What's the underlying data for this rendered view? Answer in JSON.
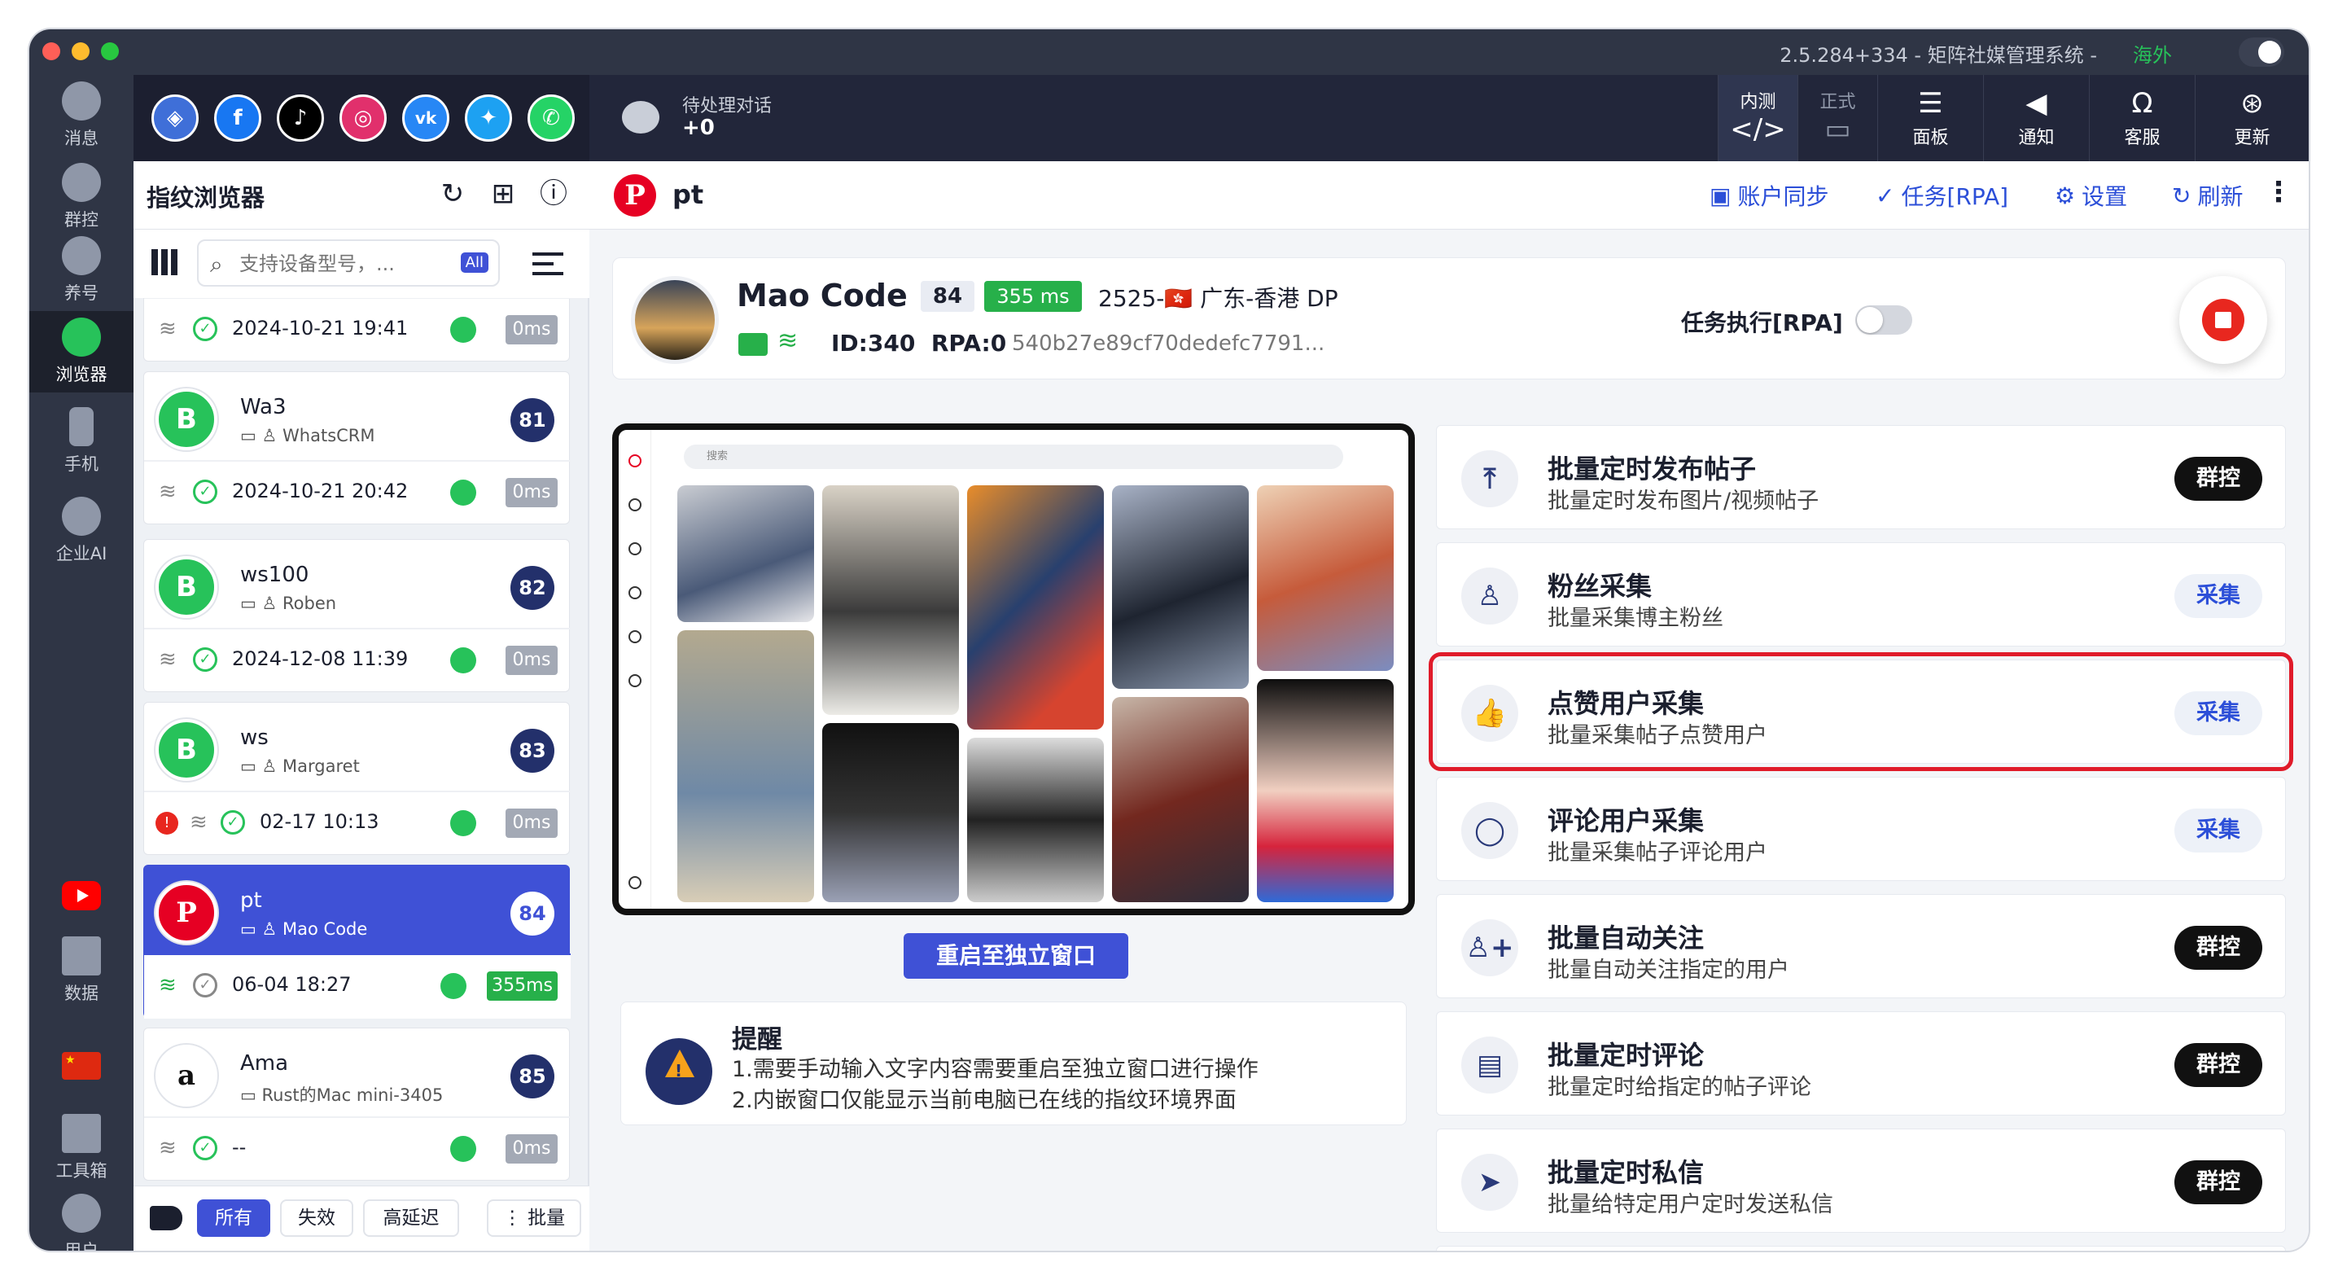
{
  "titlebar": {
    "title": "2.5.284+334 - 矩阵社媒管理系统 -",
    "region": "海外"
  },
  "colors": {
    "accent": "#3f51d6",
    "nav_bg": "#2f3545",
    "success": "#27b04a",
    "danger": "#e01b2a",
    "stop": "#e8271f"
  },
  "leftnav": {
    "messages": "消息",
    "group": "群控",
    "nurture": "养号",
    "browser": "浏览器",
    "phone": "手机",
    "enterprise_ai": "企业AI",
    "data": "数据",
    "toolbox": "工具箱",
    "user": "用户"
  },
  "topbar": {
    "pending_label": "待处理对话",
    "pending_count": "+0",
    "beta_label": "内测",
    "prod_label": "正式",
    "panel": "面板",
    "notify": "通知",
    "support": "客服",
    "update": "更新"
  },
  "social_icons": [
    "browser-icon",
    "facebook-icon",
    "tiktok-icon",
    "instagram-icon",
    "vk-icon",
    "twitter-icon",
    "whatsapp-icon"
  ],
  "sidepanel": {
    "title": "指纹浏览器",
    "search_placeholder": "支持设备型号，...",
    "all_badge": "All",
    "items": [
      {
        "name": "",
        "device": "",
        "owner": "",
        "num": "",
        "time": "2024-10-21 19:41",
        "ms": "0ms"
      },
      {
        "name": "Wa3",
        "owner": "WhatsCRM",
        "num": "81",
        "time": "2024-10-21 20:42",
        "ms": "0ms"
      },
      {
        "name": "ws100",
        "owner": "Roben",
        "num": "82",
        "time": "2024-12-08 11:39",
        "ms": "0ms"
      },
      {
        "name": "ws",
        "owner": "Margaret",
        "num": "83",
        "time": "02-17 10:13",
        "ms": "0ms"
      },
      {
        "name": "pt",
        "owner": "Mao Code",
        "num": "84",
        "time": "06-04 18:27",
        "ms": "355ms"
      },
      {
        "name": "Ama",
        "owner": "Rust的Mac mini-3405",
        "num": "85",
        "time": "--",
        "ms": "0ms"
      }
    ],
    "footer": {
      "all": "所有",
      "invalid": "失效",
      "high_latency": "高延迟",
      "batch": "批量"
    }
  },
  "main": {
    "header": {
      "title": "pt",
      "sync": "账户同步",
      "task": "任务[RPA]",
      "settings": "设置",
      "refresh": "刷新"
    },
    "profile": {
      "name": "Mao Code",
      "level": "84",
      "latency": "355 ms",
      "location": "2525-🇭🇰 广东-香港 DP",
      "id": "ID:340",
      "rpa": "RPA:0",
      "hash": "540b27e89cf70dedefc7791...",
      "task_label": "任务执行[RPA]"
    },
    "embed": {
      "search": "搜索",
      "reopen": "重启至独立窗口"
    },
    "notice": {
      "title": "提醒",
      "line1": "1.需要手动输入文字内容需要重启至独立窗口进行操作",
      "line2": "2.内嵌窗口仅能显示当前电脑已在线的指纹环境界面"
    },
    "features": [
      {
        "title": "批量定时发布帖子",
        "desc": "批量定时发布图片/视频帖子",
        "btn": "群控"
      },
      {
        "title": "粉丝采集",
        "desc": "批量采集博主粉丝",
        "btn": "采集"
      },
      {
        "title": "点赞用户采集",
        "desc": "批量采集帖子点赞用户",
        "btn": "采集"
      },
      {
        "title": "评论用户采集",
        "desc": "批量采集帖子评论用户",
        "btn": "采集"
      },
      {
        "title": "批量自动关注",
        "desc": "批量自动关注指定的用户",
        "btn": "群控"
      },
      {
        "title": "批量定时评论",
        "desc": "批量定时给指定的帖子评论",
        "btn": "群控"
      },
      {
        "title": "批量定时私信",
        "desc": "批量给特定用户定时发送私信",
        "btn": "群控"
      }
    ]
  }
}
